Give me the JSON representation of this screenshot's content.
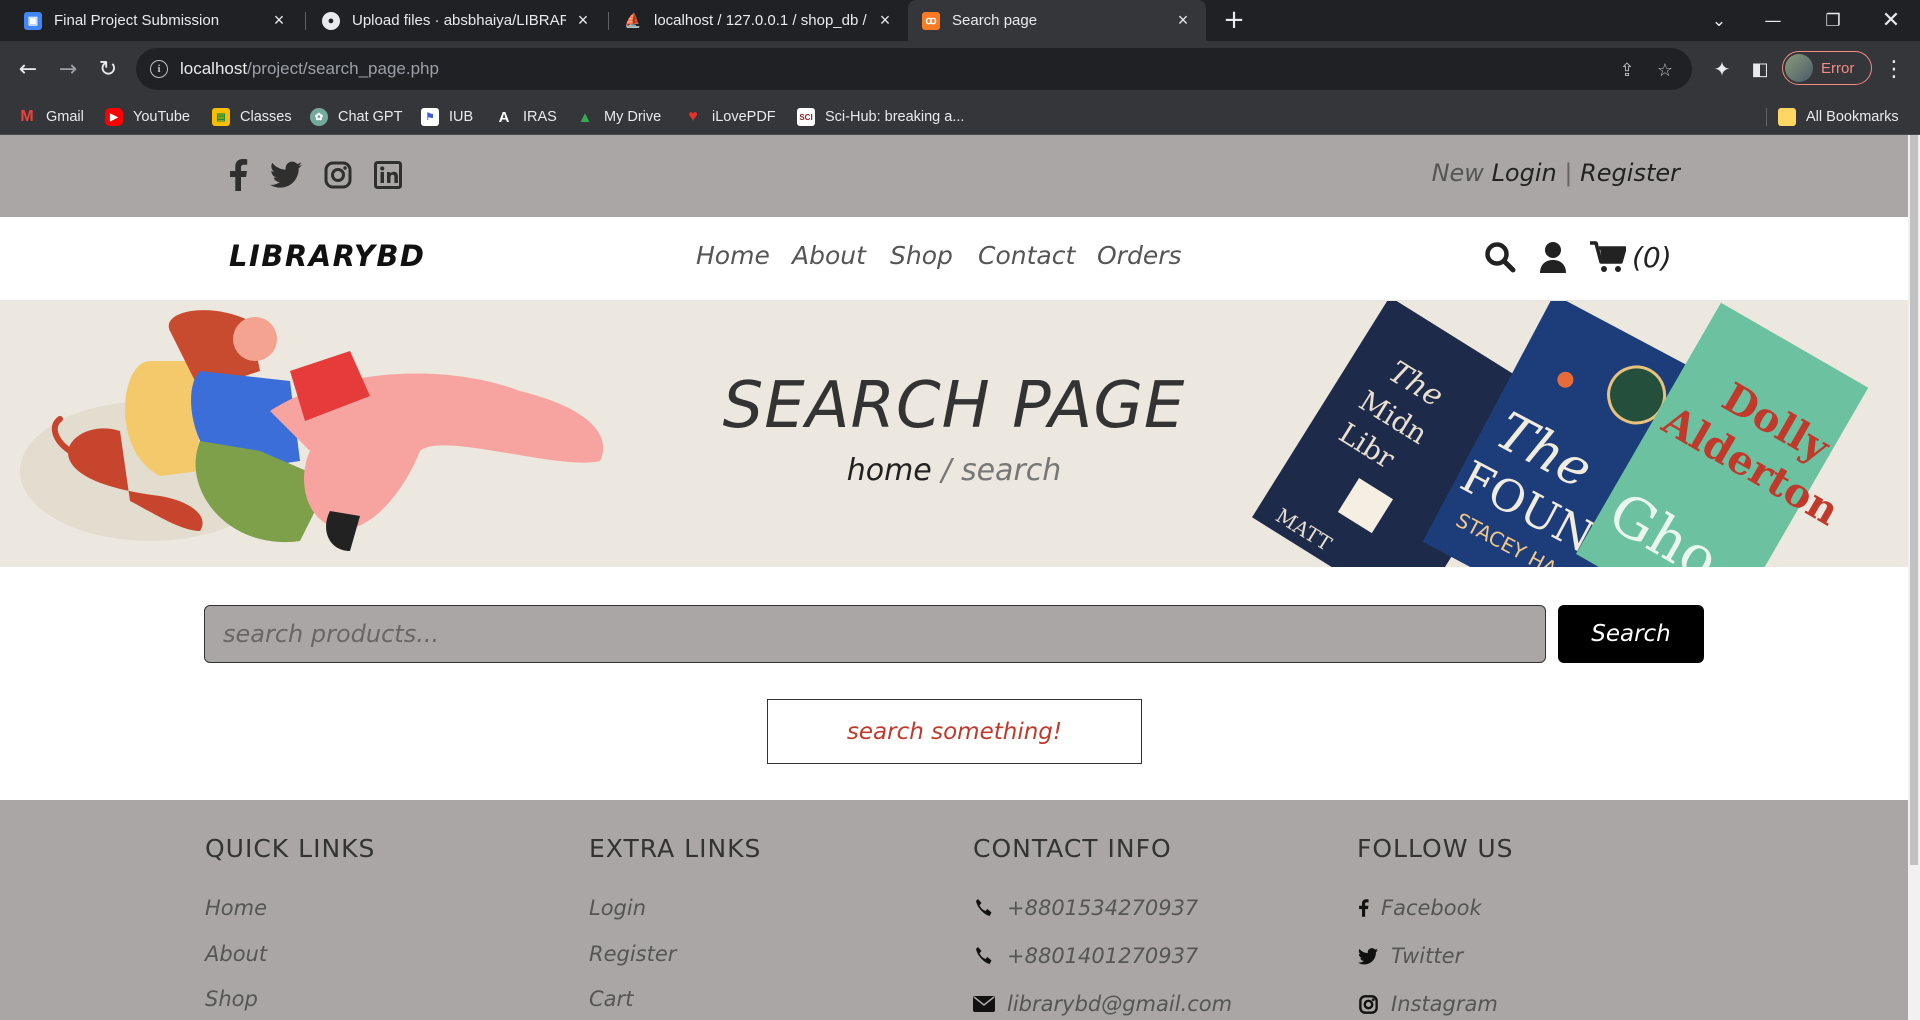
{
  "browser": {
    "tabs": [
      {
        "title": "Final Project Submission",
        "icon": "classroom-icon",
        "active": false
      },
      {
        "title": "Upload files · absbhaiya/LIBRAR",
        "icon": "github-icon",
        "active": false
      },
      {
        "title": "localhost / 127.0.0.1 / shop_db /",
        "icon": "phpmyadmin-icon",
        "active": false
      },
      {
        "title": "Search page",
        "icon": "xampp-icon",
        "active": true
      }
    ],
    "url_host": "localhost",
    "url_path": "/project/search_page.php",
    "profile_label": "Error",
    "bookmarks": [
      {
        "label": "Gmail",
        "icon": "gmail-icon",
        "color": "#ea4335"
      },
      {
        "label": "YouTube",
        "icon": "youtube-icon",
        "color": "#ff0000"
      },
      {
        "label": "Classes",
        "icon": "classroom-icon",
        "color": "#fbbc04"
      },
      {
        "label": "Chat GPT",
        "icon": "chatgpt-icon",
        "color": "#74aa9c"
      },
      {
        "label": "IUB",
        "icon": "iub-icon",
        "color": "#3b5bdb"
      },
      {
        "label": "IRAS",
        "icon": "iras-icon",
        "color": "#222222"
      },
      {
        "label": "My Drive",
        "icon": "drive-icon",
        "color": "#34a853"
      },
      {
        "label": "iLovePDF",
        "icon": "ilovepdf-icon",
        "color": "#e5322d"
      },
      {
        "label": "Sci-Hub: breaking a...",
        "icon": "scihub-icon",
        "color": "#9b2226"
      }
    ],
    "all_bookmarks": "All Bookmarks"
  },
  "topbar": {
    "social": [
      "facebook-icon",
      "twitter-icon",
      "instagram-icon",
      "linkedin-icon"
    ],
    "new": "New",
    "login": "Login",
    "separator": "|",
    "register": "Register"
  },
  "header": {
    "logo": "LIBRARYBD",
    "nav": [
      "Home",
      "About",
      "Shop",
      "Contact",
      "Orders"
    ],
    "cart_count": "(0)"
  },
  "banner": {
    "title": "SEARCH PAGE",
    "crumb_home": "home",
    "crumb_sep": " / ",
    "crumb_current": "search"
  },
  "search": {
    "placeholder": "search products...",
    "button": "Search"
  },
  "empty_message": "search something!",
  "footer": {
    "quick_links": {
      "title": "QUICK LINKS",
      "items": [
        "Home",
        "About",
        "Shop"
      ]
    },
    "extra_links": {
      "title": "EXTRA LINKS",
      "items": [
        "Login",
        "Register",
        "Cart"
      ]
    },
    "contact": {
      "title": "CONTACT INFO",
      "items": [
        {
          "icon": "phone-icon",
          "text": "+8801534270937"
        },
        {
          "icon": "phone-icon",
          "text": "+8801401270937"
        },
        {
          "icon": "envelope-icon",
          "text": "librarybd@gmail.com"
        }
      ]
    },
    "follow": {
      "title": "FOLLOW US",
      "items": [
        {
          "icon": "facebook-icon",
          "text": "Facebook"
        },
        {
          "icon": "twitter-icon",
          "text": "Twitter"
        },
        {
          "icon": "instagram-icon",
          "text": "Instagram"
        }
      ]
    }
  },
  "colors": {
    "topbar_bg": "#aaa6a6",
    "banner_bg": "#ece8df",
    "button_bg": "#000000",
    "empty_text": "#c0392b"
  }
}
